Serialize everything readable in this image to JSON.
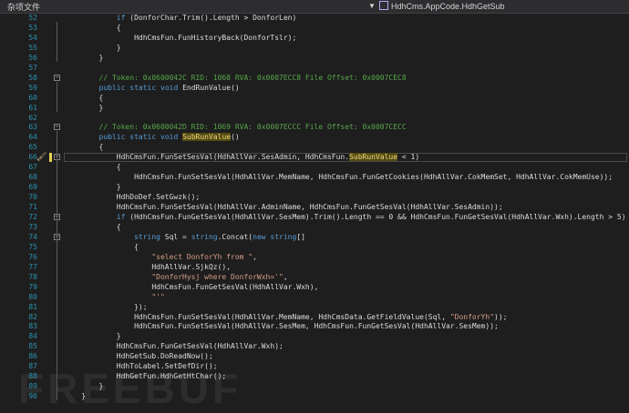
{
  "topbar": {
    "left_label": "杂项文件",
    "dropdown_icon": "chevron-down-icon",
    "active_member": "HdhCms.AppCode.HdhGetSub"
  },
  "watermark": "FREEBUF",
  "colors": {
    "background": "#1e1e1e",
    "line_number": "#2b91af",
    "keyword": "#569cd6",
    "comment": "#57a64a",
    "string": "#d69d85",
    "highlight": "#514a12"
  },
  "lines": [
    {
      "n": "52",
      "text": "            if (DonforChar.Trim().Length > DonforLen)"
    },
    {
      "n": "53",
      "text": "            {"
    },
    {
      "n": "54",
      "text": "                HdhCmsFun.FunHistoryBack(DonforTslr);"
    },
    {
      "n": "55",
      "text": "            }"
    },
    {
      "n": "56",
      "text": "        }"
    },
    {
      "n": "57",
      "text": ""
    },
    {
      "n": "58",
      "text": "        // Token: 0x0600042C RID: 1068 RVA: 0x0007ECC8 File Offset: 0x0007CEC8"
    },
    {
      "n": "59",
      "text": "        public static void EndRunValue()"
    },
    {
      "n": "60",
      "text": "        {"
    },
    {
      "n": "61",
      "text": "        }"
    },
    {
      "n": "62",
      "text": ""
    },
    {
      "n": "63",
      "text": "        // Token: 0x0600042D RID: 1069 RVA: 0x0007ECCC File Offset: 0x0007CECC"
    },
    {
      "n": "64",
      "text": "        public static void SubRunValue()"
    },
    {
      "n": "65",
      "text": "        {"
    },
    {
      "n": "66",
      "text": "            HdhCmsFun.FunSetSesVal(HdhAllVar.SesAdmin, HdhCmsFun.SubRunValue < 1)"
    },
    {
      "n": "67",
      "text": "            {"
    },
    {
      "n": "68",
      "text": "                HdhCmsFun.FunSetSesVal(HdhAllVar.MemName, HdhCmsFun.FunGetCookies(HdhAllVar.CokMemSet, HdhAllVar.CokMemUse));"
    },
    {
      "n": "69",
      "text": "            }"
    },
    {
      "n": "70",
      "text": "            HdhDoDef.SetGwzk();"
    },
    {
      "n": "71",
      "text": "            HdhCmsFun.FunSetSesVal(HdhAllVar.AdminName, HdhCmsFun.FunGetSesVal(HdhAllVar.SesAdmin));"
    },
    {
      "n": "72",
      "text": "            if (HdhCmsFun.FunGetSesVal(HdhAllVar.SesMem).Trim().Length == 0 && HdhCmsFun.FunGetSesVal(HdhAllVar.Wxh).Length > 5)"
    },
    {
      "n": "73",
      "text": "            {"
    },
    {
      "n": "74",
      "text": "                string Sql = string.Concat(new string[]"
    },
    {
      "n": "75",
      "text": "                {"
    },
    {
      "n": "76",
      "text": "                    \"select DonforYh from \","
    },
    {
      "n": "77",
      "text": "                    HdhAllVar.SjkQz(),"
    },
    {
      "n": "78",
      "text": "                    \"DonforHysj where DonforWxh='\","
    },
    {
      "n": "79",
      "text": "                    HdhCmsFun.FunGetSesVal(HdhAllVar.Wxh),"
    },
    {
      "n": "80",
      "text": "                    \"'\""
    },
    {
      "n": "81",
      "text": "                });"
    },
    {
      "n": "82",
      "text": "                HdhCmsFun.FunSetSesVal(HdhAllVar.MemName, HdhCmsData.GetFieldValue(Sql, \"DonforYh\"));"
    },
    {
      "n": "83",
      "text": "                HdhCmsFun.FunSetSesVal(HdhAllVar.SesMem, HdhCmsFun.FunGetSesVal(HdhAllVar.SesMem));"
    },
    {
      "n": "84",
      "text": "            }"
    },
    {
      "n": "85",
      "text": "            HdhCmsFun.FunGetSesVal(HdhAllVar.Wxh);"
    },
    {
      "n": "86",
      "text": "            HdhGetSub.DoReadNow();"
    },
    {
      "n": "87",
      "text": "            HdhToLabel.SetDefDir();"
    },
    {
      "n": "88",
      "text": "            HdhGetFun.HdhGetHtChar();"
    },
    {
      "n": "89",
      "text": "        }"
    },
    {
      "n": "90",
      "text": "    }"
    }
  ]
}
